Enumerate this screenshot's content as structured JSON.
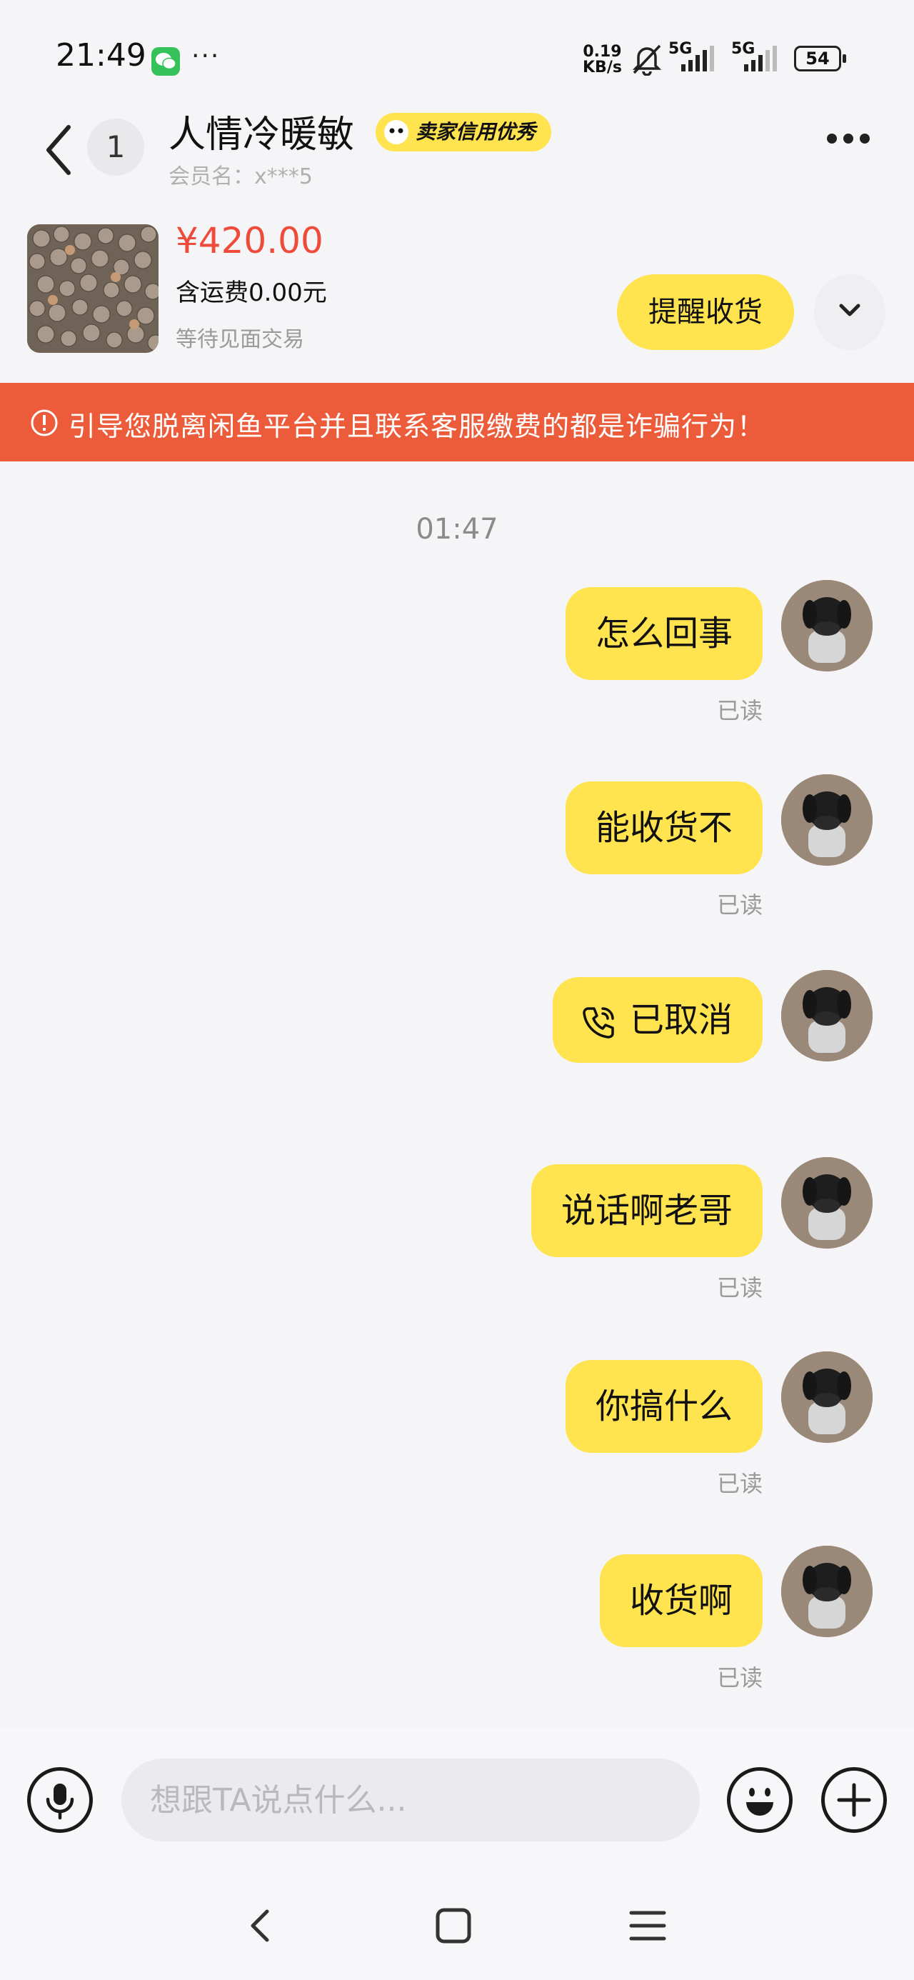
{
  "status_bar": {
    "time": "21:49",
    "overflow": "···",
    "net_speed_value": "0.19",
    "net_speed_unit": "KB/s",
    "signal1": "5G",
    "signal2": "5G",
    "battery": "54",
    "icons": [
      "wechat-icon",
      "bell-muted-icon",
      "signal-icon",
      "battery-icon"
    ]
  },
  "header": {
    "unread_count": "1",
    "seller_name": "人情冷暖敏",
    "credit_badge": "卖家信用优秀",
    "member_line": "会员名：x***5"
  },
  "product": {
    "price": "¥420.00",
    "shipping": "含运费0.00元",
    "status": "等待见面交易",
    "remind_button": "提醒收货"
  },
  "warning": {
    "text": "引导您脱离闲鱼平台并且联系客服缴费的都是诈骗行为！"
  },
  "chat": {
    "timestamp": "01:47",
    "messages": [
      {
        "text": "怎么回事",
        "read": "已读"
      },
      {
        "text": "能收货不",
        "read": "已读"
      },
      {
        "text": "已取消",
        "type": "call"
      },
      {
        "text": "说话啊老哥",
        "read": "已读"
      },
      {
        "text": "你搞什么",
        "read": "已读"
      },
      {
        "text": "收货啊",
        "read": "已读"
      }
    ]
  },
  "input": {
    "placeholder": "想跟TA说点什么..."
  },
  "colors": {
    "accent_yellow": "#ffe34f",
    "price_red": "#ee4b3a",
    "warning_bg": "#ec5c3a",
    "background": "#f5f5f7"
  }
}
